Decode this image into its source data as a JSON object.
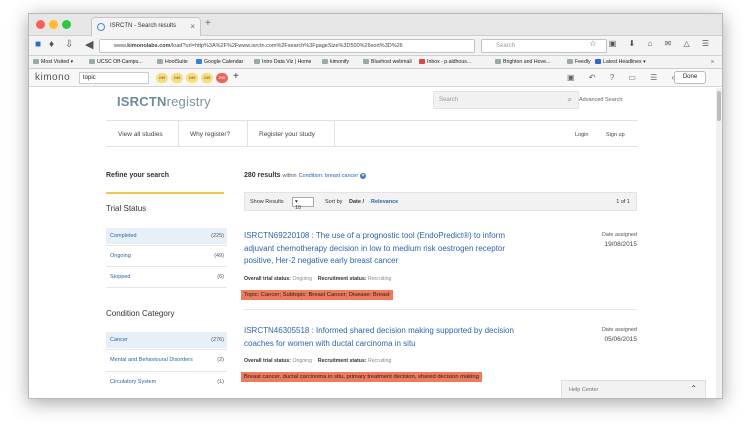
{
  "browser": {
    "tab_title": "ISRCTN - Search results",
    "new_tab": "+",
    "url_prefix": "www.",
    "url_host": "kimonolabs.com",
    "url_rest": "/load?url=http%3A%2F%2Fwww.isrctn.com%2Fsearch%3FpageSize%3D500%26sort%3D%26",
    "search_placeholder": "Search"
  },
  "bookmarks": [
    "Most Visited ▾",
    "UCSC Off-Campu...",
    "HootSuite",
    "Google Calendar",
    "Intro Data Viz | Home",
    "kimonify",
    "Bluehost webmail",
    "Inbox - p.aldhous...",
    "Brighton and Hove...",
    "Feedly",
    "Latest Headlines ▾",
    "»"
  ],
  "kimono": {
    "logo": "kimono",
    "input_value": "topic",
    "pills": [
      "249",
      "249",
      "249",
      "249",
      "249"
    ],
    "done_label": "Done"
  },
  "site": {
    "brand_a": "ISRCTN",
    "brand_b": "registry",
    "search_placeholder": "Search",
    "advanced_search": "Advanced Search",
    "nav": [
      "View all studies",
      "Why register?",
      "Register your study"
    ],
    "login": "Login",
    "signup": "Sign up"
  },
  "sidebar": {
    "refine": "Refine your search",
    "trial_status_heading": "Trial Status",
    "trial_status": [
      {
        "label": "Completed",
        "count": "(225)"
      },
      {
        "label": "Ongoing",
        "count": "(49)"
      },
      {
        "label": "Stopped",
        "count": "(6)"
      }
    ],
    "condition_heading": "Condition Category",
    "conditions": [
      {
        "label": "Cancer",
        "count": "(276)"
      },
      {
        "label": "Mental and Behavioural Disorders",
        "count": "(2)"
      },
      {
        "label": "Circulatory System",
        "count": "(1)"
      }
    ]
  },
  "results": {
    "count": "280 results",
    "within": "within",
    "condition": "Condition: breast cancer",
    "show_results": "Show Results",
    "page_size": "10",
    "sort_by": "Sort by",
    "sort_date": "Date /",
    "sort_relevance": "Relevance",
    "pagination": "1 of 1",
    "items": [
      {
        "title_l1": "ISRCTN69220108 : The use of a prognostic tool (EndoPredict®) to inform",
        "title_l2": "adjuvant chemotherapy decision in low to medium risk oestrogen receptor",
        "title_l3": "positive, Her-2 negative early breast cancer",
        "date_label": "Date assigned",
        "date": "19/08/2015",
        "overall_label": "Overall trial status:",
        "overall_value": "Ongoing",
        "recruit_label": "Recruitment status:",
        "recruit_value": "Recruiting",
        "highlight": "Topic: Cancer; Subtopic: Breast Cancer; Disease: Breast"
      },
      {
        "title_l1": "ISRCTN46305518 : Informed shared decision making supported by decision",
        "title_l2": "coaches for women with ductal carcinoma in situ",
        "date_label": "Date assigned",
        "date": "05/06/2015",
        "overall_label": "Overall trial status:",
        "overall_value": "Ongoing",
        "recruit_label": "Recruitment status:",
        "recruit_value": "Recruiting",
        "highlight": "Breast cancer, ductal carcinoma in situ, primary treatment decision, shared decision making"
      }
    ]
  },
  "help_center": "Help Center",
  "colors": {
    "highlight": "#ef7a5e",
    "link": "#2e64aa",
    "accent_line": "#f3c64a"
  }
}
